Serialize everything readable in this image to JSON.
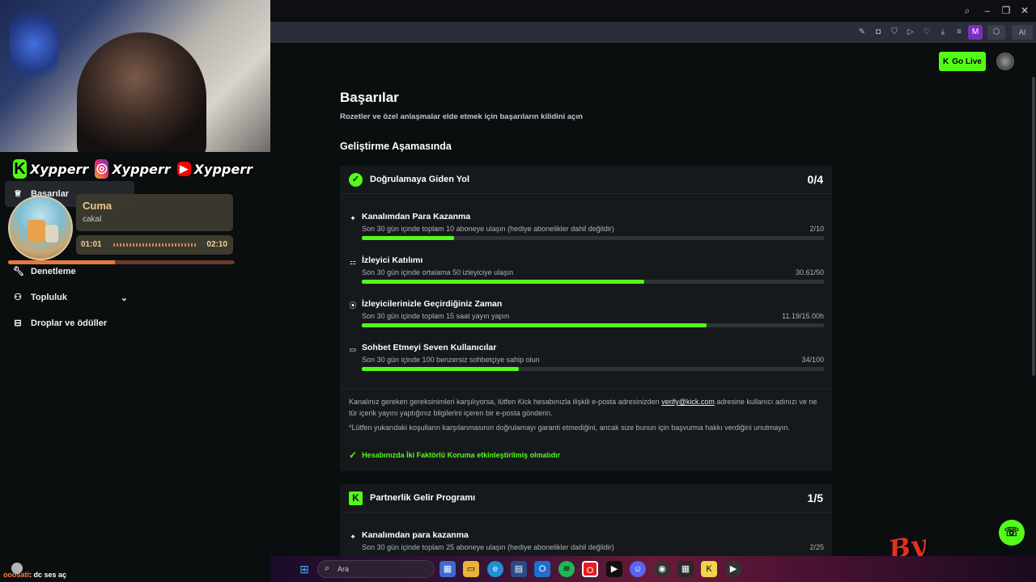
{
  "overlay": {
    "socials": [
      {
        "platform": "kick-icon",
        "handle": "Xypperr",
        "color": "#53fc18",
        "glyph": "K"
      },
      {
        "platform": "instagram-icon",
        "handle": "Xypperr",
        "color": "#e1306c",
        "glyph": "◎"
      },
      {
        "platform": "youtube-icon",
        "handle": "Xypperr",
        "color": "#ff0000",
        "glyph": "▶"
      }
    ],
    "music": {
      "title": "Cuma",
      "artist": "cakal",
      "current_time": "01:01",
      "total_time": "02:10",
      "progress": 0.47
    },
    "chat": {
      "user": "ooosati",
      "message": ": dc ses aç"
    },
    "logo_text": "By"
  },
  "sidebar": {
    "items": [
      {
        "label": "Başarılar",
        "icon": "trophy-icon",
        "active": true
      },
      {
        "label": "Denetleme",
        "icon": "wrench-icon",
        "active": false
      },
      {
        "label": "Topluluk",
        "icon": "people-icon",
        "active": false,
        "expandable": true
      },
      {
        "label": "Droplar ve ödüller",
        "icon": "gift-icon",
        "active": false
      }
    ]
  },
  "header": {
    "go_live_label": "Go Live",
    "toolbar_extension_label": "AI",
    "profile_letter": "M"
  },
  "page": {
    "title": "Başarılar",
    "subtitle": "Rozetler ve özel anlaşmalar elde etmek için başarıların kilidini açın",
    "section_heading": "Geliştirme Aşamasında"
  },
  "verification_card": {
    "title": "Doğrulamaya Giden Yol",
    "count": "0/4",
    "requirements": [
      {
        "icon": "sparkle-icon",
        "title": "Kanalımdan Para Kazanma",
        "desc": "Son 30 gün içinde toplam 10 aboneye ulaşın (hediye abonelikler dahil değildir)",
        "value": "2/10",
        "progress": 0.2
      },
      {
        "icon": "audience-icon",
        "title": "İzleyici Katılımı",
        "desc": "Son 30 gün içinde ortalama 50 izleyiciye ulaşın",
        "value": "30.61/50",
        "progress": 0.612
      },
      {
        "icon": "broadcast-icon",
        "title": "İzleyicilerinizle Geçirdiğiniz Zaman",
        "desc": "Son 30 gün içinde toplam 15 saat yayın yapın",
        "value": "11.19/15.00h",
        "progress": 0.746
      },
      {
        "icon": "chat-icon",
        "title": "Sohbet Etmeyi Seven Kullanıcılar",
        "desc": "Son 30 gün içinde 100 benzersiz sohbetçiye sahip olun",
        "value": "34/100",
        "progress": 0.34
      }
    ],
    "note_1_before": "Kanalınız gereken gereksinimleri karşılıyorsa, lütfen Kick hesabınızla ilişkili e-posta adresinizden ",
    "note_1_link": "verify@kick.com",
    "note_1_after": " adresine kullanıcı adınızı ve ne tür içerik yayını yaptığınız bilgilerini içeren bir e-posta gönderin.",
    "note_2": "*Lütfen yukarıdaki koşulların karşılanmasının doğrulamayı garanti etmediğini, ancak size bunun için başvurma hakkı verdiğini unutmayın.",
    "twofa": "Hesabınızda İki Faktörlü Koruma etkinleştirilmiş olmalıdır"
  },
  "partner_card": {
    "title": "Partnerlik Gelir Programı",
    "count": "1/5",
    "requirements": [
      {
        "icon": "sparkle-icon",
        "title": "Kanalımdan para kazanma",
        "desc": "Son 30 gün içinde toplam 25 aboneye ulaşın (hediye abonelikler dahil değildir)",
        "value": "2/25",
        "progress": 0.08
      }
    ]
  },
  "taskbar": {
    "search_placeholder": "Ara"
  },
  "colors": {
    "accent": "#53fc18",
    "background": "#0b0e0f",
    "card": "#16191c"
  }
}
